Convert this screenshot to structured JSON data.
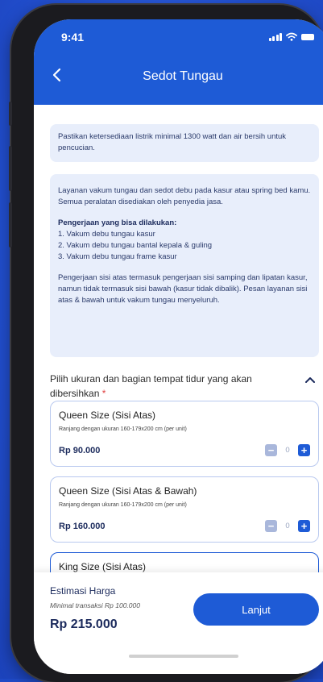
{
  "status_bar": {
    "time": "9:41"
  },
  "header": {
    "title": "Sedot Tungau"
  },
  "notices": {
    "power": "Pastikan ketersediaan listrik minimal 1300 watt dan air bersih untuk pencucian.",
    "service_desc": "Layanan vakum tungau dan sedot debu pada kasur atau spring bed kamu. Semua peralatan disediakan oleh penyedia jasa.",
    "work_heading": "Pengerjaan yang bisa dilakukan:",
    "work_items": [
      "1. Vakum debu tungau kasur",
      "2. Vakum debu tungau bantal kepala & guling",
      "3. Vakum debu tungau frame kasur"
    ],
    "work_note": "Pengerjaan sisi atas termasuk pengerjaan sisi samping dan lipatan kasur, namun tidak termasuk sisi bawah (kasur tidak dibalik). Pesan layanan sisi atas & bawah untuk vakum tungau menyeluruh."
  },
  "size_section": {
    "label": "Pilih ukuran dan bagian tempat tidur yang akan dibersihkan",
    "required_mark": "*"
  },
  "options": [
    {
      "name": "Queen Size (Sisi Atas)",
      "desc": "Ranjang dengan ukuran 160-179x200 cm (per unit)",
      "price": "Rp 90.000",
      "qty": "0"
    },
    {
      "name": "Queen Size (Sisi Atas & Bawah)",
      "desc": "Ranjang dengan ukuran 160-179x200 cm (per unit)",
      "price": "Rp 160.000",
      "qty": "0"
    },
    {
      "name": "King Size (Sisi Atas)"
    }
  ],
  "footer": {
    "estimate_label": "Estimasi Harga",
    "min_transaction": "Minimal transaksi Rp 100.000",
    "total": "Rp 215.000",
    "next_label": "Lanjut"
  },
  "colors": {
    "primary": "#1e5bd6",
    "notice_bg": "#e8eefb",
    "price_text": "#1b2a5c",
    "required": "#e04141"
  },
  "icons": {
    "back": "chevron-left-icon",
    "collapse": "chevron-up-icon",
    "minus": "minus-icon",
    "plus": "plus-icon"
  }
}
